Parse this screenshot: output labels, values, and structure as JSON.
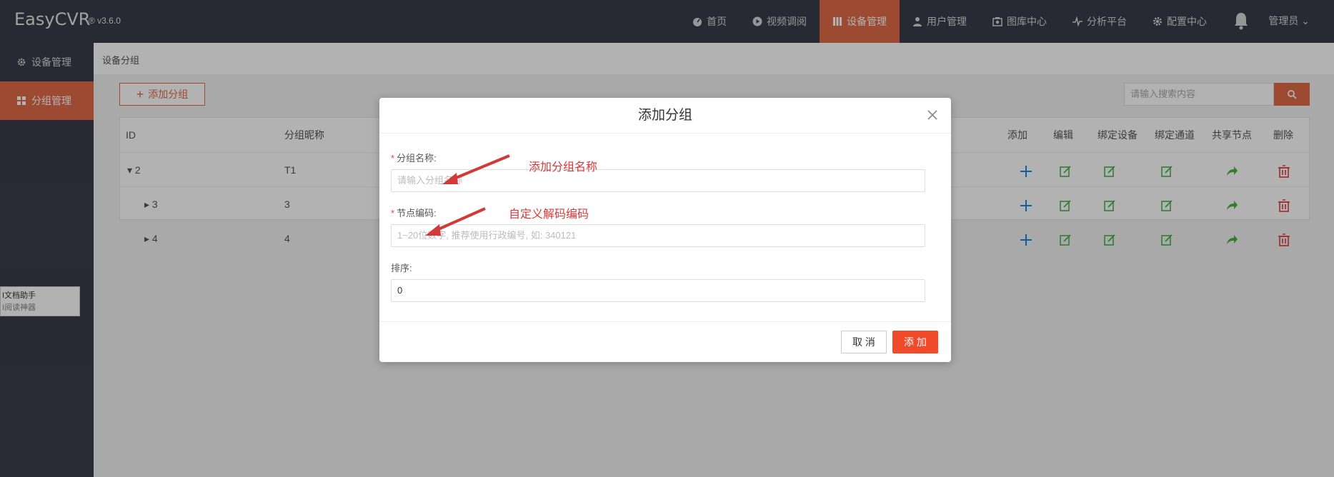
{
  "app": {
    "brand": "EasyCVR",
    "version": "® v3.6.0"
  },
  "nav": {
    "items": [
      {
        "label": "首页",
        "icon": "dashboard-icon"
      },
      {
        "label": "视频调阅",
        "icon": "play-circle-icon"
      },
      {
        "label": "设备管理",
        "icon": "device-icon",
        "active": true
      },
      {
        "label": "用户管理",
        "icon": "user-icon"
      },
      {
        "label": "图库中心",
        "icon": "gallery-icon"
      },
      {
        "label": "分析平台",
        "icon": "pulse-icon"
      },
      {
        "label": "配置中心",
        "icon": "gear-icon"
      }
    ],
    "admin_label": "管理员"
  },
  "sidebar": {
    "items": [
      {
        "label": "设备管理",
        "icon": "gear-icon"
      },
      {
        "label": "分组管理",
        "icon": "grid-icon",
        "active": true
      }
    ]
  },
  "content": {
    "breadcrumb": "设备分组",
    "add_group_label": "添加分组",
    "search_placeholder": "请输入搜索内容"
  },
  "table": {
    "headers": {
      "id": "ID",
      "name": "分组昵称",
      "add": "添加",
      "edit": "编辑",
      "bind_device": "绑定设备",
      "bind_channel": "绑定通道",
      "share_node": "共享节点",
      "delete": "删除"
    },
    "rows": [
      {
        "id": "2",
        "name": "T1",
        "expanded": true
      },
      {
        "id": "3",
        "name": "3",
        "expanded": false
      },
      {
        "id": "4",
        "name": "4",
        "expanded": false
      }
    ]
  },
  "doc_widget": {
    "title": "I文档助手",
    "subtitle": "I阅读神器"
  },
  "modal": {
    "title": "添加分组",
    "group_name_label": "分组名称:",
    "group_name_placeholder": "请输入分组名称",
    "node_code_label": "节点编码:",
    "node_code_placeholder": "1~20位数字, 推荐使用行政编号, 如: 340121",
    "sort_label": "排序:",
    "sort_value": "0",
    "cancel_label": "取 消",
    "add_label": "添 加"
  },
  "annotations": {
    "group_name_note": "添加分组名称",
    "node_code_note": "自定义解码编码"
  },
  "colors": {
    "accent": "#e06a48",
    "nav_bg": "#393d49",
    "primary_button": "#f14a2a",
    "annotation": "#d23a3a"
  }
}
